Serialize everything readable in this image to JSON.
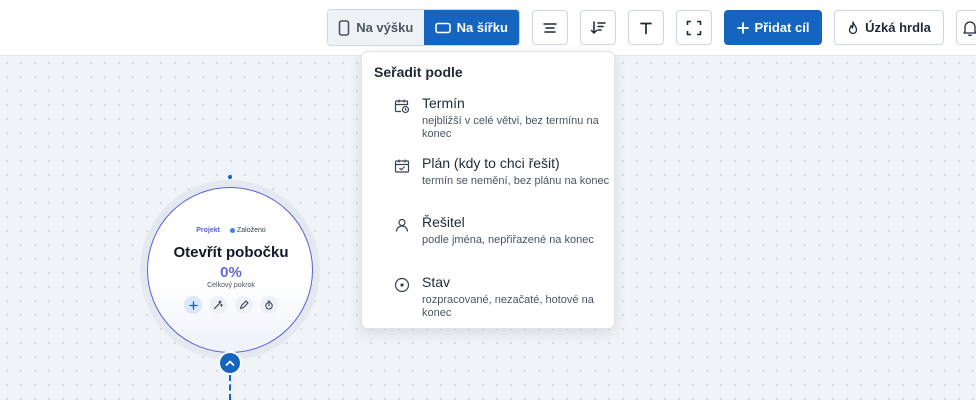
{
  "toolbar": {
    "layout_toggle": {
      "vertical_label": "Na výšku",
      "horizontal_label": "Na šířku",
      "selected": "horizontal"
    },
    "align_icon": "align-center-icon",
    "sort_icon": "sort-descending-icon",
    "text_icon": "text-icon",
    "fullscreen_icon": "fullscreen-icon",
    "add_goal_label": "Přidat cíl",
    "bottlenecks_label": "Úzká hrdla",
    "bell_icon": "bell-icon"
  },
  "sort_menu": {
    "title": "Seřadit podle",
    "options": [
      {
        "icon": "calendar-clock-icon",
        "label": "Termín",
        "description": "nejbližší v celé větvi, bez termínu na konec"
      },
      {
        "icon": "calendar-check-icon",
        "label": "Plán (kdy to chci řešit)",
        "description": "termín se nemění, bez plánu na konec"
      },
      {
        "icon": "user-icon",
        "label": "Řešitel",
        "description": "podle jména, nepřiřazené na konec"
      },
      {
        "icon": "status-circle-icon",
        "label": "Stav",
        "description": "rozpracované, nezačaté, hotové na konec"
      }
    ]
  },
  "node": {
    "type_tag": "Projekt",
    "status_tag": "Založeno",
    "title": "Otevřít pobočku",
    "progress_text": "0%",
    "progress_caption": "Celkový pokrok",
    "actions": [
      "plus-icon",
      "magic-wand-icon",
      "pencil-icon",
      "timer-icon"
    ]
  },
  "colors": {
    "accent": "#1565c0",
    "node_border": "#5b5fd6",
    "progress": "#6366d8"
  }
}
